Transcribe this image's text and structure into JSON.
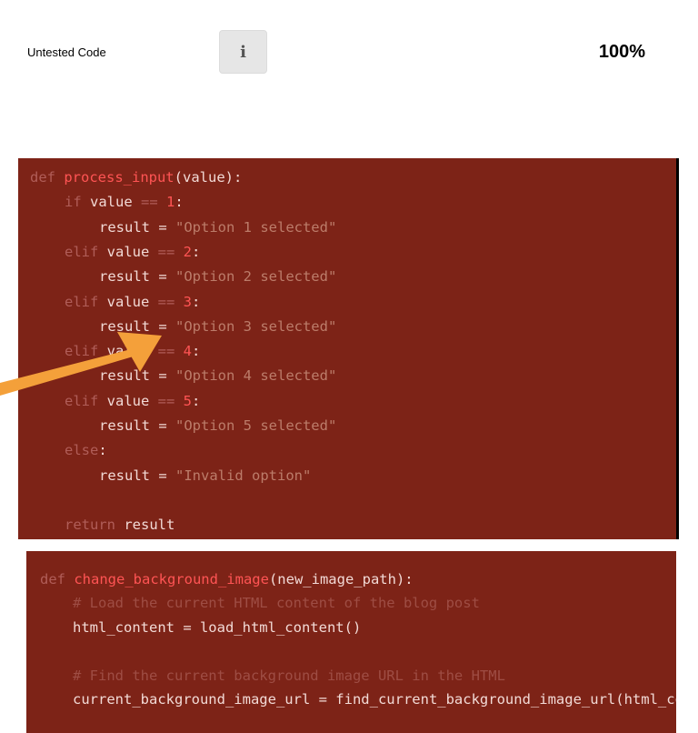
{
  "header": {
    "label": "Untested Code",
    "info_icon": "info-icon",
    "info_glyph": "i",
    "percent": "100%"
  },
  "colors": {
    "code_background": "#7d2317",
    "keyword": "#b05d58",
    "function_name": "#ff5454",
    "string": "#bc7c6a",
    "comment": "#9e4d44",
    "identifier": "#f2dad6",
    "arrow": "#f4a03a"
  },
  "code_block_1": {
    "lines": [
      {
        "indent": 0,
        "tokens": [
          {
            "t": "kw",
            "v": "def "
          },
          {
            "t": "fn",
            "v": "process_input"
          },
          {
            "t": "plain",
            "v": "(value):"
          }
        ]
      },
      {
        "indent": 1,
        "tokens": [
          {
            "t": "kw",
            "v": "if "
          },
          {
            "t": "var",
            "v": "value"
          },
          {
            "t": "kw",
            "v": " == "
          },
          {
            "t": "num",
            "v": "1"
          },
          {
            "t": "plain",
            "v": ":"
          }
        ]
      },
      {
        "indent": 2,
        "tokens": [
          {
            "t": "var",
            "v": "result"
          },
          {
            "t": "plain",
            "v": " = "
          },
          {
            "t": "str",
            "v": "\"Option 1 selected\""
          }
        ]
      },
      {
        "indent": 1,
        "tokens": [
          {
            "t": "kw",
            "v": "elif "
          },
          {
            "t": "var",
            "v": "value"
          },
          {
            "t": "kw",
            "v": " == "
          },
          {
            "t": "num",
            "v": "2"
          },
          {
            "t": "plain",
            "v": ":"
          }
        ]
      },
      {
        "indent": 2,
        "tokens": [
          {
            "t": "var",
            "v": "result"
          },
          {
            "t": "plain",
            "v": " = "
          },
          {
            "t": "str",
            "v": "\"Option 2 selected\""
          }
        ]
      },
      {
        "indent": 1,
        "tokens": [
          {
            "t": "kw",
            "v": "elif "
          },
          {
            "t": "var",
            "v": "value"
          },
          {
            "t": "kw",
            "v": " == "
          },
          {
            "t": "num",
            "v": "3"
          },
          {
            "t": "plain",
            "v": ":"
          }
        ]
      },
      {
        "indent": 2,
        "tokens": [
          {
            "t": "var",
            "v": "result"
          },
          {
            "t": "plain",
            "v": " = "
          },
          {
            "t": "str",
            "v": "\"Option 3 selected\""
          }
        ]
      },
      {
        "indent": 1,
        "tokens": [
          {
            "t": "kw",
            "v": "elif "
          },
          {
            "t": "var",
            "v": "value"
          },
          {
            "t": "kw",
            "v": " == "
          },
          {
            "t": "num",
            "v": "4"
          },
          {
            "t": "plain",
            "v": ":"
          }
        ]
      },
      {
        "indent": 2,
        "tokens": [
          {
            "t": "var",
            "v": "result"
          },
          {
            "t": "plain",
            "v": " = "
          },
          {
            "t": "str",
            "v": "\"Option 4 selected\""
          }
        ]
      },
      {
        "indent": 1,
        "tokens": [
          {
            "t": "kw",
            "v": "elif "
          },
          {
            "t": "var",
            "v": "value"
          },
          {
            "t": "kw",
            "v": " == "
          },
          {
            "t": "num",
            "v": "5"
          },
          {
            "t": "plain",
            "v": ":"
          }
        ]
      },
      {
        "indent": 2,
        "tokens": [
          {
            "t": "var",
            "v": "result"
          },
          {
            "t": "plain",
            "v": " = "
          },
          {
            "t": "str",
            "v": "\"Option 5 selected\""
          }
        ]
      },
      {
        "indent": 1,
        "tokens": [
          {
            "t": "kw",
            "v": "else"
          },
          {
            "t": "plain",
            "v": ":"
          }
        ]
      },
      {
        "indent": 2,
        "tokens": [
          {
            "t": "var",
            "v": "result"
          },
          {
            "t": "plain",
            "v": " = "
          },
          {
            "t": "str",
            "v": "\"Invalid option\""
          }
        ]
      },
      {
        "indent": 0,
        "tokens": []
      },
      {
        "indent": 1,
        "tokens": [
          {
            "t": "kw",
            "v": "return "
          },
          {
            "t": "var",
            "v": "result"
          }
        ]
      }
    ]
  },
  "code_block_2": {
    "lines": [
      {
        "indent": 0,
        "tokens": [
          {
            "t": "kw",
            "v": "def "
          },
          {
            "t": "fn",
            "v": "change_background_image"
          },
          {
            "t": "plain",
            "v": "(new_image_path):"
          }
        ]
      },
      {
        "indent": 1,
        "tokens": [
          {
            "t": "cmt",
            "v": "# Load the current HTML content of the blog post"
          }
        ]
      },
      {
        "indent": 1,
        "tokens": [
          {
            "t": "var",
            "v": "html_content"
          },
          {
            "t": "plain",
            "v": " = load_html_content()"
          }
        ]
      },
      {
        "indent": 0,
        "tokens": []
      },
      {
        "indent": 1,
        "tokens": [
          {
            "t": "cmt",
            "v": "# Find the current background image URL in the HTML"
          }
        ]
      },
      {
        "indent": 1,
        "tokens": [
          {
            "t": "var",
            "v": "current_background_image_url"
          },
          {
            "t": "plain",
            "v": " = find_current_background_image_url(html_co"
          }
        ]
      }
    ]
  }
}
